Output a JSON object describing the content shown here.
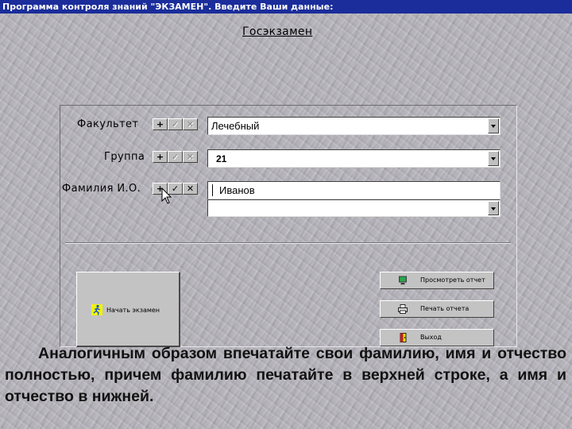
{
  "window": {
    "title": "Программа контроля знаний \"ЭКЗАМЕН\". Введите Ваши данные:"
  },
  "heading": "Госэкзамен",
  "form": {
    "faculty": {
      "label": "Факультет",
      "value": "Лечебный"
    },
    "group": {
      "label": "Группа",
      "value": "21"
    },
    "name": {
      "label": "Фамилия И.О.",
      "surname": "Иванов",
      "given": ""
    },
    "mini_buttons": {
      "add": "+",
      "confirm": "✓",
      "delete": "✕"
    }
  },
  "buttons": {
    "start_exam": "Начать экзамен",
    "view_report": "Просмотреть отчет",
    "print_report": "Печать отчета",
    "exit": "Выход"
  },
  "icons": {
    "start_exam": "running-man-icon",
    "view_report": "monitor-icon",
    "print_report": "printer-icon",
    "exit": "exit-door-icon"
  },
  "colors": {
    "titlebar": "#1a2d9a",
    "background": "#b5b3ba",
    "button_face": "#c3c3c3"
  },
  "caption": "Аналогичным образом впечатайте свои фамилию, имя и отчество полностью, причем фамилию печатайте в верхней строке, а имя и отчество в нижней."
}
